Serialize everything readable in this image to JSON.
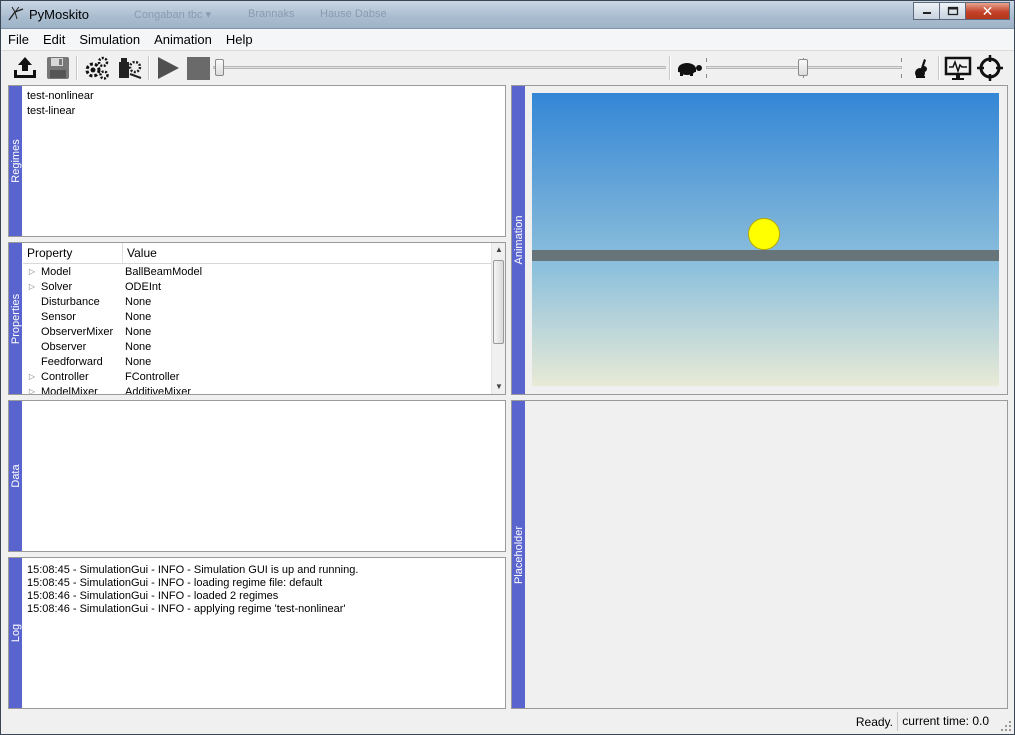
{
  "window": {
    "title": "PyMoskito",
    "background_tabs": [
      "Congaban tbc ▾",
      "Brannaks",
      "Hause Dabse"
    ]
  },
  "menu": [
    "File",
    "Edit",
    "Simulation",
    "Animation",
    "Help"
  ],
  "toolbar": {
    "icons": [
      "load-regimes-icon",
      "save-icon",
      "settings-icon",
      "batch-run-icon",
      "play-icon",
      "stop-icon",
      "turtle-icon",
      "rabbit-icon",
      "display-icon",
      "target-icon"
    ],
    "time_slider_value": 0.0,
    "speed_slider_value": 0.5
  },
  "regimes": {
    "dock_title": "Regimes",
    "items": [
      "test-nonlinear",
      "test-linear"
    ]
  },
  "properties": {
    "dock_title": "Properties",
    "header": {
      "property": "Property",
      "value": "Value"
    },
    "rows": [
      {
        "name": "Model",
        "value": "BallBeamModel",
        "expandable": true
      },
      {
        "name": "Solver",
        "value": "ODEInt",
        "expandable": true
      },
      {
        "name": "Disturbance",
        "value": "None",
        "expandable": false
      },
      {
        "name": "Sensor",
        "value": "None",
        "expandable": false
      },
      {
        "name": "ObserverMixer",
        "value": "None",
        "expandable": false
      },
      {
        "name": "Observer",
        "value": "None",
        "expandable": false
      },
      {
        "name": "Feedforward",
        "value": "None",
        "expandable": false
      },
      {
        "name": "Controller",
        "value": "FController",
        "expandable": true
      },
      {
        "name": "ModelMixer",
        "value": "AdditiveMixer",
        "expandable": true
      }
    ]
  },
  "data_dock": {
    "dock_title": "Data"
  },
  "log": {
    "dock_title": "Log",
    "lines": [
      "15:08:45 - SimulationGui - INFO - Simulation GUI is up and running.",
      "15:08:45 - SimulationGui - INFO - loading regime file: default",
      "15:08:46 - SimulationGui - INFO - loaded 2 regimes",
      "15:08:46 - SimulationGui - INFO - applying regime 'test-nonlinear'"
    ]
  },
  "animation": {
    "dock_title": "Animation",
    "colors": {
      "sky_top": "#3386d6",
      "sky_bottom": "#e8ead6",
      "beam": "#67757a",
      "ball": "#ffff00"
    }
  },
  "placeholder": {
    "dock_title": "Placeholder"
  },
  "status": {
    "ready": "Ready.",
    "time": "current time: 0.0"
  }
}
